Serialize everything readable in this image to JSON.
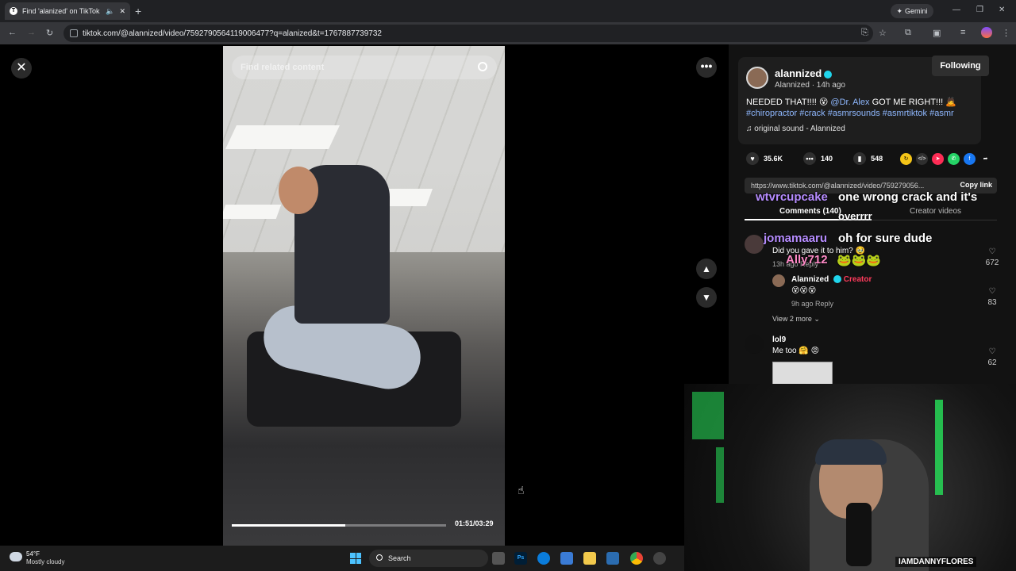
{
  "browser": {
    "tab_title": "Find 'alanized' on TikTok | T",
    "tab_favicon": "T",
    "new_tab": "+",
    "gemini_label": "Gemini",
    "url": "tiktok.com/@alannized/video/7592790564119006477?q=alanized&t=1767887739732",
    "back": "←",
    "forward": "→",
    "reload": "↻"
  },
  "video": {
    "search_placeholder": "Find related content",
    "timecode": "01:51/03:29",
    "progress_fraction": 0.53
  },
  "post": {
    "author": "alannized",
    "author_sub": "Alannized · 14h ago",
    "follow_label": "Following",
    "caption_1": "NEEDED THAT!!!! 😵",
    "caption_mention": "@Dr. Alex",
    "caption_2": "GOT ME RIGHT!!! 🙇",
    "hashtags": "#chiropractor #crack #asmrsounds #asmrtiktok #asmr",
    "sound": "♫  original sound - Alannized",
    "likes": "35.6K",
    "comments": "140",
    "saves": "548",
    "link_url": "https://www.tiktok.com/@alannized/video/759279056...",
    "copy_link": "Copy link",
    "tab_comments": "Comments (140)",
    "tab_creator": "Creator videos"
  },
  "overlay": {
    "user1": "wtvrcupcake",
    "msg1a": "one wrong crack and it's",
    "msg1b": "overrrr",
    "user2": "jomamaaru",
    "msg2": "oh for sure dude",
    "user3": "Ally712"
  },
  "comments": [
    {
      "text": "Did you gave it to him? 🥹",
      "meta": "13h ago   Reply",
      "likes": "672"
    },
    {
      "author": "Alannized",
      "tag": "Creator",
      "text": "😵😵😵",
      "meta": "9h ago    Reply",
      "likes": "83"
    },
    {
      "view_more": "View 2 more ⌄"
    },
    {
      "author": "lol9",
      "text": "Me too 🤗 😡",
      "likes": "62"
    }
  ],
  "stream": {
    "handle": "IAMDANNYFLORES"
  },
  "taskbar": {
    "temp": "54°F",
    "weather": "Mostly cloudy",
    "search": "Search"
  },
  "colors": {
    "accent_link": "#8fb8ff",
    "creator_red": "#ff3b5c",
    "verified": "#20d5ec"
  }
}
